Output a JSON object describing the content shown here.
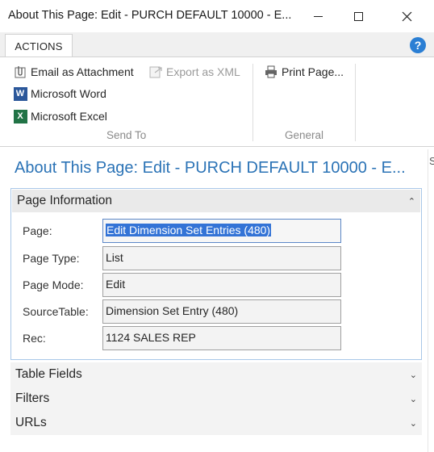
{
  "window": {
    "title": "About This Page: Edit - PURCH DEFAULT 10000 - E..."
  },
  "ribbon": {
    "tab_label": "ACTIONS",
    "help_label": "?",
    "send_to": {
      "items": [
        {
          "label": "Email as Attachment",
          "icon": "paperclip-icon",
          "enabled": true
        },
        {
          "label": "Export as XML",
          "icon": "export-xml-icon",
          "enabled": false
        },
        {
          "label": "Microsoft Word",
          "icon": "word-icon",
          "enabled": true
        },
        {
          "label": "Microsoft Excel",
          "icon": "excel-icon",
          "enabled": true
        }
      ],
      "group_label": "Send To"
    },
    "general": {
      "items": [
        {
          "label": "Print Page...",
          "icon": "printer-icon",
          "enabled": true
        }
      ],
      "group_label": "General"
    }
  },
  "page": {
    "title": "About This Page: Edit - PURCH DEFAULT 10000 - E...",
    "edge_glyph": "S"
  },
  "page_information": {
    "header": "Page Information",
    "fields": [
      {
        "label": "Page:",
        "value": "Edit Dimension Set Entries (480)"
      },
      {
        "label": "Page Type:",
        "value": "List"
      },
      {
        "label": "Page Mode:",
        "value": "Edit"
      },
      {
        "label": "SourceTable:",
        "value": "Dimension Set Entry (480)"
      },
      {
        "label": "Rec:",
        "value": "1124 SALES REP"
      }
    ]
  },
  "collapsed_sections": [
    {
      "label": "Table Fields"
    },
    {
      "label": "Filters"
    },
    {
      "label": "URLs"
    }
  ],
  "colors": {
    "accent": "#2b73b6",
    "selection": "#3373d6",
    "word": "#2b579a",
    "excel": "#217346",
    "help": "#2b7fd4"
  }
}
